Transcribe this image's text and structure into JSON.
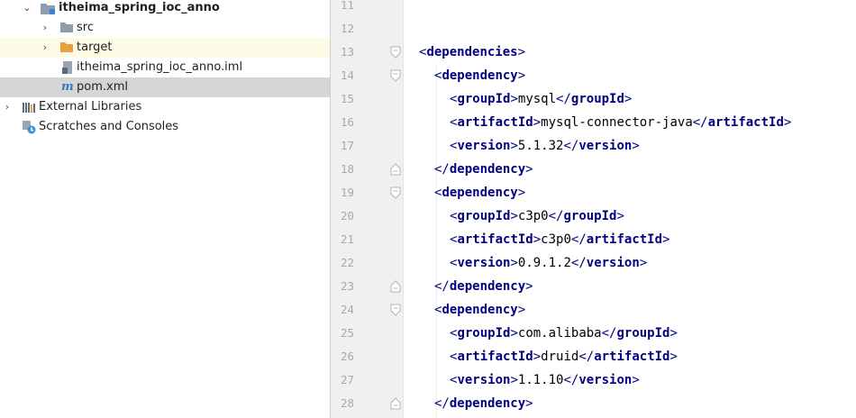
{
  "project_tree": {
    "items": [
      {
        "label": "itheima_spring_ioc_anno",
        "icon": "module-folder-icon"
      },
      {
        "label": "src",
        "icon": "folder-icon"
      },
      {
        "label": "target",
        "icon": "folder-icon"
      },
      {
        "label": "itheima_spring_ioc_anno.iml",
        "icon": "iml-file-icon"
      },
      {
        "label": "pom.xml",
        "icon": "maven-file-icon",
        "prefix": "m"
      },
      {
        "label": "External Libraries",
        "icon": "libraries-icon"
      },
      {
        "label": "Scratches and Consoles",
        "icon": "scratches-icon"
      }
    ]
  },
  "editor": {
    "lines": [
      {
        "num": "11",
        "tag": "",
        "text": "",
        "kind": "empty"
      },
      {
        "num": "12",
        "tag": "",
        "text": "",
        "kind": "empty"
      },
      {
        "num": "13",
        "tag": "dependencies",
        "text": "",
        "kind": "open"
      },
      {
        "num": "14",
        "tag": "dependency",
        "text": "",
        "kind": "open"
      },
      {
        "num": "15",
        "tag": "groupId",
        "text": "mysql",
        "kind": "element"
      },
      {
        "num": "16",
        "tag": "artifactId",
        "text": "mysql-connector-java",
        "kind": "element"
      },
      {
        "num": "17",
        "tag": "version",
        "text": "5.1.32",
        "kind": "element"
      },
      {
        "num": "18",
        "tag": "dependency",
        "text": "",
        "kind": "close"
      },
      {
        "num": "19",
        "tag": "dependency",
        "text": "",
        "kind": "open"
      },
      {
        "num": "20",
        "tag": "groupId",
        "text": "c3p0",
        "kind": "element"
      },
      {
        "num": "21",
        "tag": "artifactId",
        "text": "c3p0",
        "kind": "element"
      },
      {
        "num": "22",
        "tag": "version",
        "text": "0.9.1.2",
        "kind": "element"
      },
      {
        "num": "23",
        "tag": "dependency",
        "text": "",
        "kind": "close"
      },
      {
        "num": "24",
        "tag": "dependency",
        "text": "",
        "kind": "open"
      },
      {
        "num": "25",
        "tag": "groupId",
        "text": "com.alibaba",
        "kind": "element"
      },
      {
        "num": "26",
        "tag": "artifactId",
        "text": "druid",
        "kind": "element"
      },
      {
        "num": "27",
        "tag": "version",
        "text": "1.1.10",
        "kind": "element"
      },
      {
        "num": "28",
        "tag": "dependency",
        "text": "",
        "kind": "close"
      }
    ]
  },
  "colors": {
    "selected_row": "#d5d5d5",
    "tag": "#000080",
    "folder": "#8b9bb0",
    "target_folder": "#e8a040",
    "gutter": "#f0f0f0"
  }
}
